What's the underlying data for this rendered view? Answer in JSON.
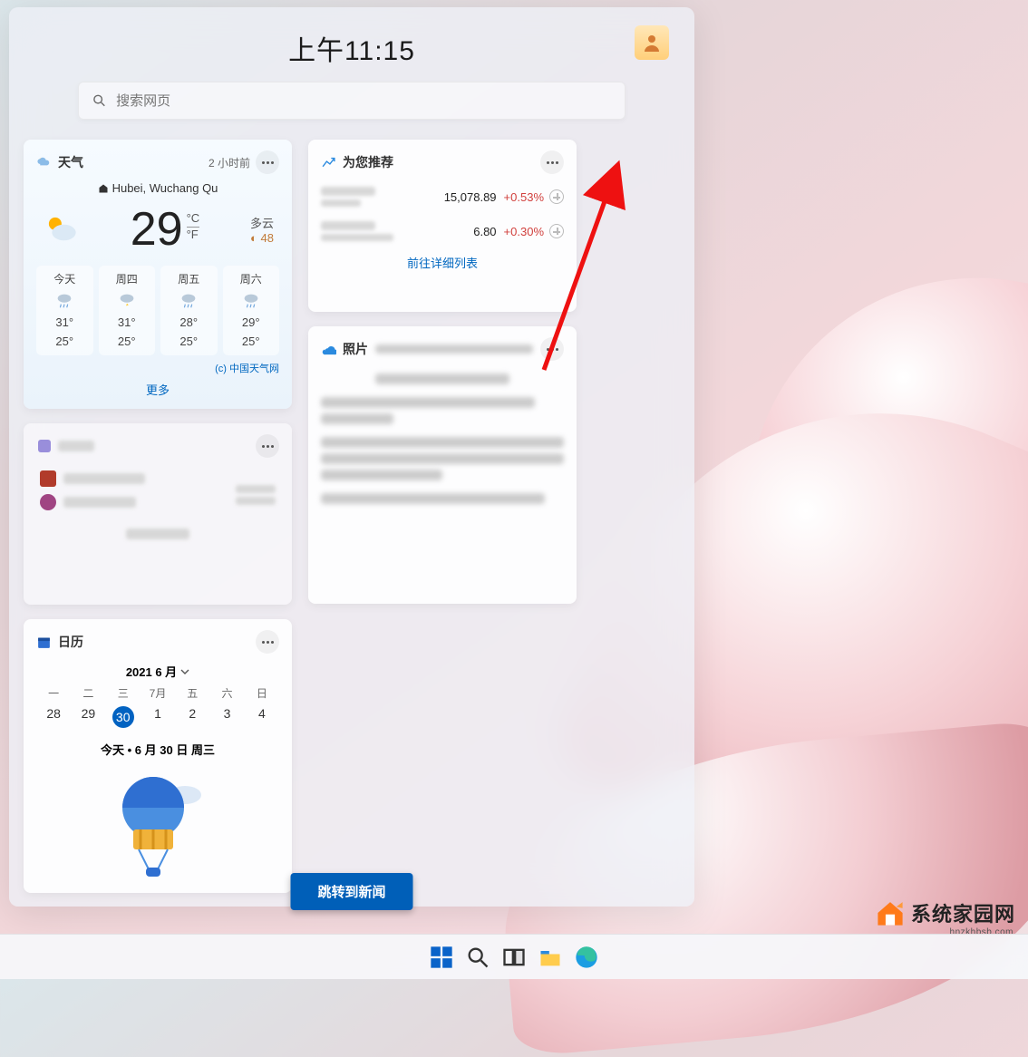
{
  "time": "上午11:15",
  "search": {
    "placeholder": "搜索网页"
  },
  "weather": {
    "title": "天气",
    "updated": "2 小时前",
    "location": "Hubei, Wuchang Qu",
    "temp": "29",
    "unit_c": "°C",
    "unit_f": "°F",
    "condition": "多云",
    "aqi": "◐ 48",
    "forecast": [
      {
        "day": "今天",
        "hi": "31°",
        "lo": "25°"
      },
      {
        "day": "周四",
        "hi": "31°",
        "lo": "25°"
      },
      {
        "day": "周五",
        "hi": "28°",
        "lo": "25°"
      },
      {
        "day": "周六",
        "hi": "29°",
        "lo": "25°"
      }
    ],
    "credit": "(c) 中国天气网",
    "more": "更多"
  },
  "stocks": {
    "title": "为您推荐",
    "rows": [
      {
        "price": "15,078.89",
        "change": "+0.53%"
      },
      {
        "price": "6.80",
        "change": "+0.30%"
      }
    ],
    "detail": "前往详细列表"
  },
  "photos": {
    "title": "照片"
  },
  "calendar": {
    "title": "日历",
    "month": "2021 6 月",
    "dow": [
      "一",
      "二",
      "三",
      "7月",
      "五",
      "六",
      "日"
    ],
    "days": [
      "28",
      "29",
      "30",
      "1",
      "2",
      "3",
      "4"
    ],
    "today_index": 2,
    "today_line": "今天 • 6 月 30 日 周三"
  },
  "news_button": "跳转到新闻",
  "watermark": {
    "text": "系统家园网",
    "sub": "hnzkhbsb.com"
  }
}
